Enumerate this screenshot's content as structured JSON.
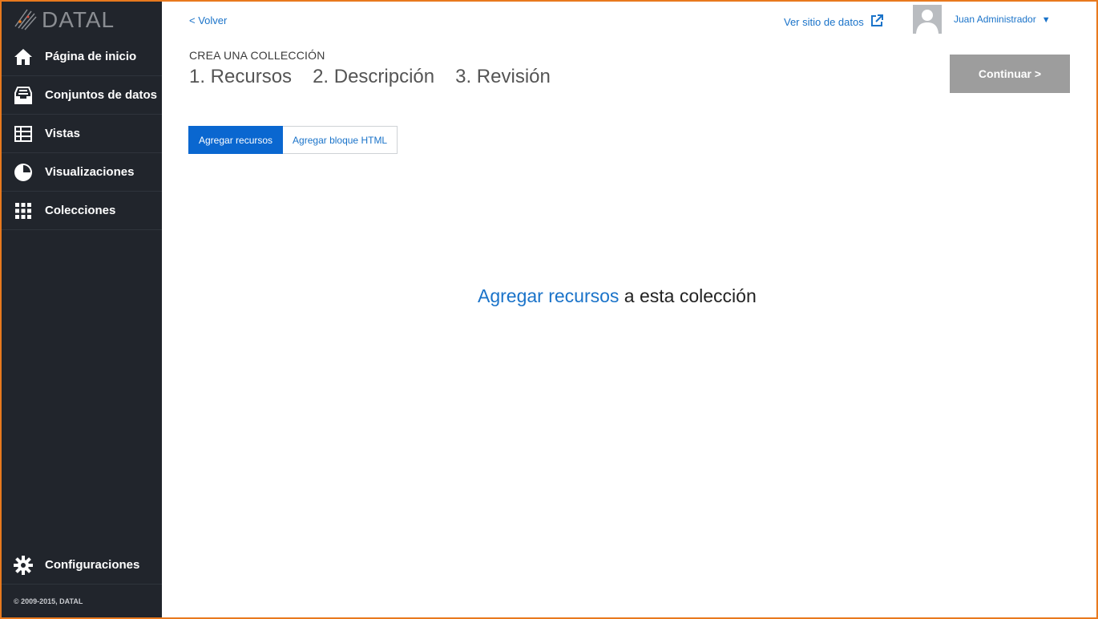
{
  "brand": {
    "name": "DATAL"
  },
  "sidebar": {
    "items": [
      {
        "label": "Página de inicio",
        "icon": "home-icon"
      },
      {
        "label": "Conjuntos de datos",
        "icon": "inbox-icon"
      },
      {
        "label": "Vistas",
        "icon": "table-icon"
      },
      {
        "label": "Visualizaciones",
        "icon": "pie-chart-icon"
      },
      {
        "label": "Colecciones",
        "icon": "grid-icon"
      }
    ],
    "config_label": "Configuraciones",
    "copyright": "© 2009-2015, DATAL"
  },
  "header": {
    "back_label": "< Volver",
    "site_link_label": "Ver sitio de datos",
    "user_name": "Juan Administrador",
    "user_caret": "▼"
  },
  "wizard": {
    "eyebrow": "CREA UNA COLLECCIÓN",
    "steps": [
      "1. Recursos",
      "2. Descripción",
      "3. Revisión"
    ],
    "continue_label": "Continuar >"
  },
  "tabs": [
    {
      "label": "Agregar recursos",
      "active": true
    },
    {
      "label": "Agregar bloque HTML",
      "active": false
    }
  ],
  "empty_state": {
    "link_text": "Agregar recursos",
    "rest_text": " a esta colección"
  },
  "colors": {
    "sidebar_bg": "#21252c",
    "accent": "#0a67d0",
    "link": "#1a73c9",
    "frame": "#e8791e",
    "disabled_button": "#9d9d9d"
  }
}
